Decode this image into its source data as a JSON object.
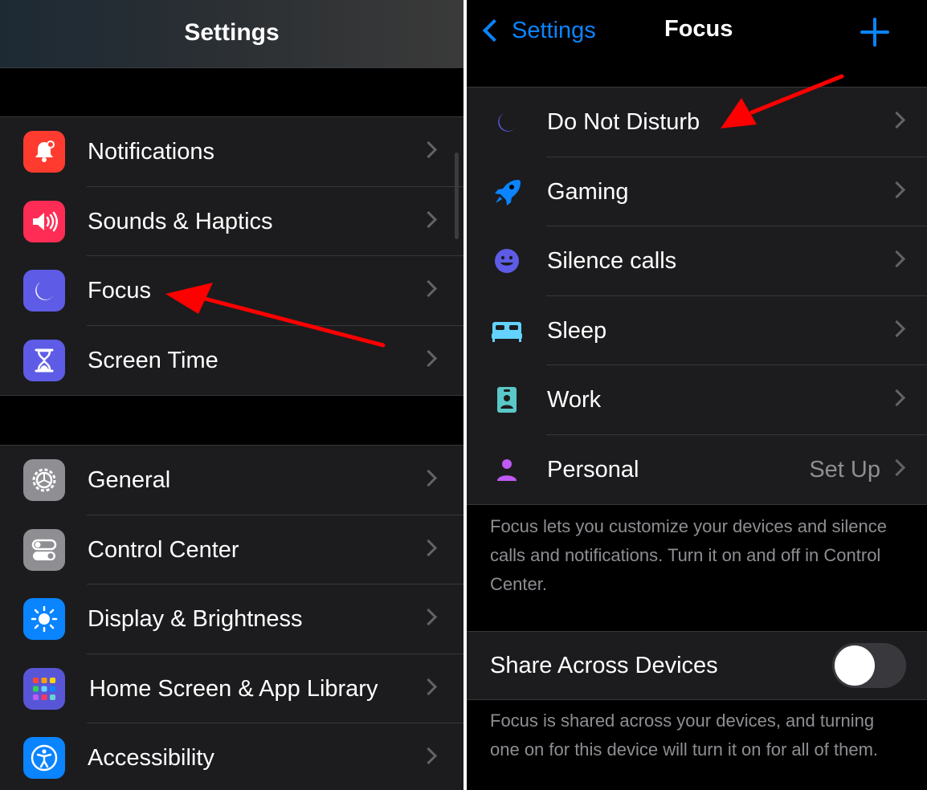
{
  "left": {
    "title": "Settings",
    "group1": [
      {
        "label": "Notifications",
        "icon": "bell-icon",
        "color": "#ff3b30"
      },
      {
        "label": "Sounds & Haptics",
        "icon": "speaker-icon",
        "color": "#ff2d55"
      },
      {
        "label": "Focus",
        "icon": "moon-icon",
        "color": "#5e5ce6"
      },
      {
        "label": "Screen Time",
        "icon": "hourglass-icon",
        "color": "#5e5ce6"
      }
    ],
    "group2": [
      {
        "label": "General",
        "icon": "gear-icon",
        "color": "#8e8e93"
      },
      {
        "label": "Control Center",
        "icon": "toggles-icon",
        "color": "#8e8e93"
      },
      {
        "label": "Display & Brightness",
        "icon": "sun-icon",
        "color": "#0a84ff"
      },
      {
        "label": "Home Screen & App Library",
        "icon": "app-grid-icon",
        "color": "#5856d6"
      },
      {
        "label": "Accessibility",
        "icon": "accessibility-icon",
        "color": "#0a84ff"
      }
    ]
  },
  "right": {
    "back_label": "Settings",
    "title": "Focus",
    "items": [
      {
        "label": "Do Not Disturb",
        "icon": "moon-icon",
        "color": "#5e5ce6",
        "detail": ""
      },
      {
        "label": "Gaming",
        "icon": "rocket-icon",
        "color": "#0a84ff",
        "detail": ""
      },
      {
        "label": "Silence calls",
        "icon": "smiley-icon",
        "color": "#5e5ce6",
        "detail": ""
      },
      {
        "label": "Sleep",
        "icon": "bed-icon",
        "color": "#64d2ff",
        "detail": ""
      },
      {
        "label": "Work",
        "icon": "id-badge-icon",
        "color": "#5ac8c8",
        "detail": ""
      },
      {
        "label": "Personal",
        "icon": "person-icon",
        "color": "#bf5af2",
        "detail": "Set Up"
      }
    ],
    "footer1": "Focus lets you customize your devices and silence calls and notifications. Turn it on and off in Control Center.",
    "share_label": "Share Across Devices",
    "share_enabled": false,
    "footer2": "Focus is shared across your devices, and turning one on for this device will turn it on for all of them."
  },
  "colors": {
    "accent": "#0a84ff",
    "annotation_arrow": "#ff0000"
  }
}
